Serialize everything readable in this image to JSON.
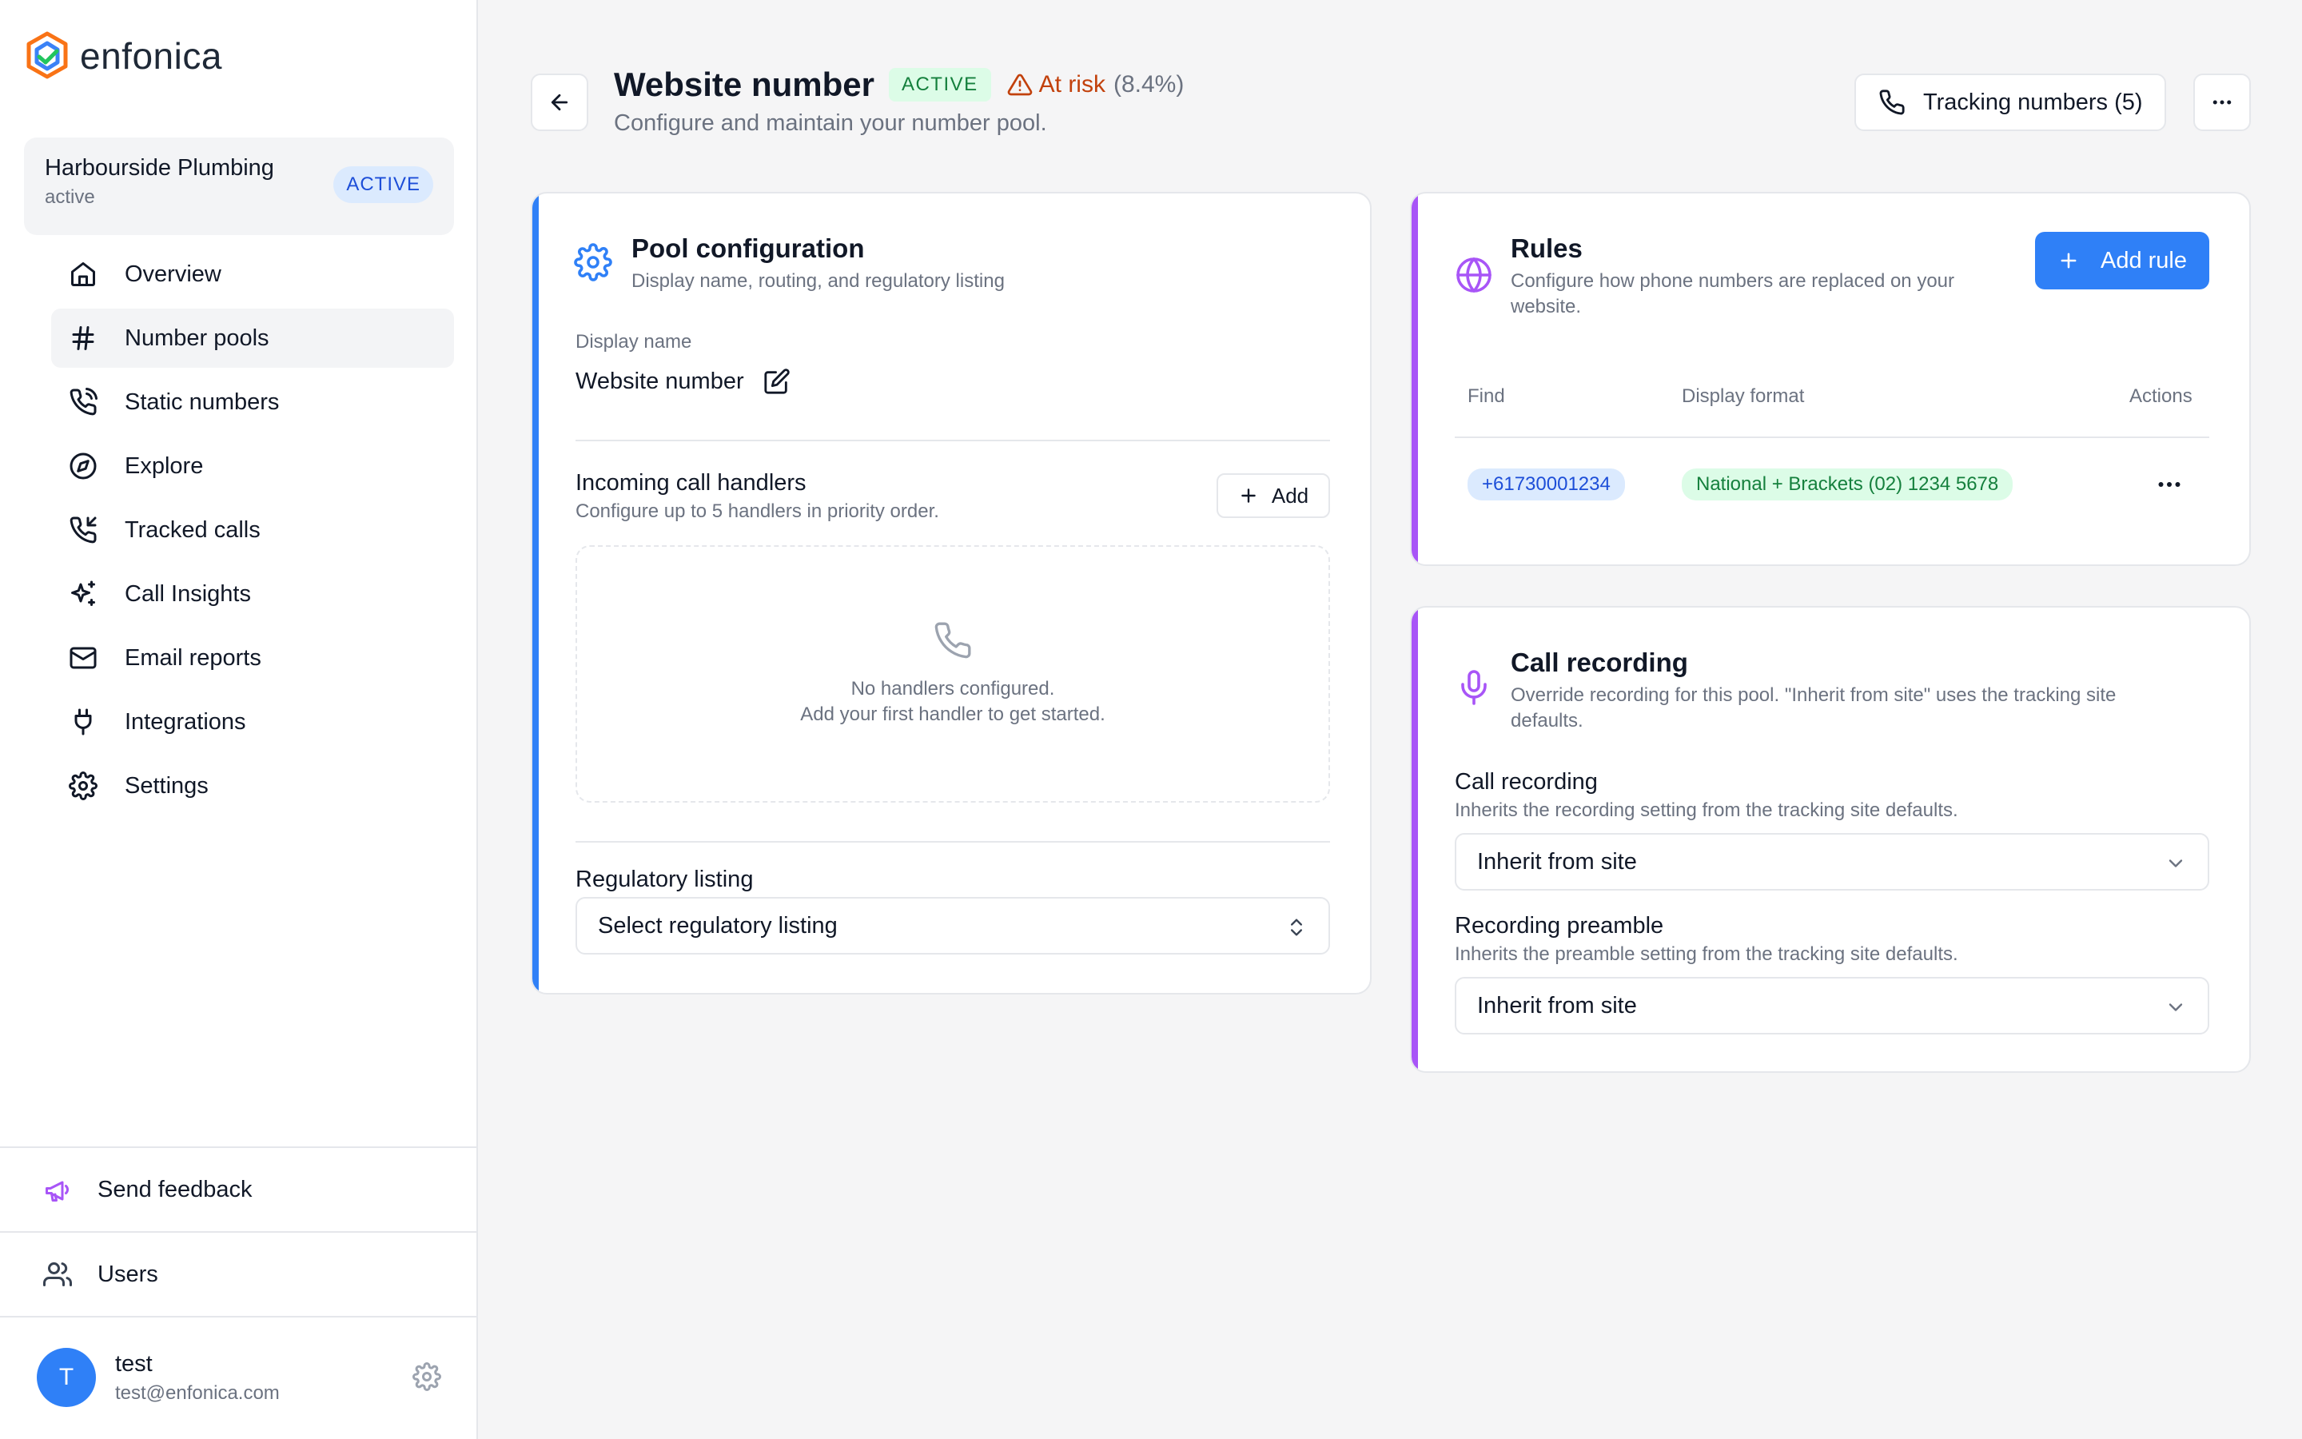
{
  "brand": {
    "name": "enfonica"
  },
  "account": {
    "name": "Harbourside Plumbing",
    "status": "active",
    "badge": "ACTIVE"
  },
  "nav": [
    {
      "label": "Overview",
      "icon": "home-icon",
      "active": false
    },
    {
      "label": "Number pools",
      "icon": "hash-icon",
      "active": true
    },
    {
      "label": "Static numbers",
      "icon": "phone-icon",
      "active": false
    },
    {
      "label": "Explore",
      "icon": "compass-icon",
      "active": false
    },
    {
      "label": "Tracked calls",
      "icon": "phone-incoming-icon",
      "active": false
    },
    {
      "label": "Call Insights",
      "icon": "sparkles-icon",
      "active": false
    },
    {
      "label": "Email reports",
      "icon": "mail-icon",
      "active": false
    },
    {
      "label": "Integrations",
      "icon": "plug-icon",
      "active": false
    },
    {
      "label": "Settings",
      "icon": "gear-icon",
      "active": false
    }
  ],
  "sidebar_bottom": {
    "feedback": "Send feedback",
    "users": "Users",
    "user": {
      "initial": "T",
      "name": "test",
      "email": "test@enfonica.com"
    }
  },
  "header": {
    "title": "Website number",
    "status_badge": "ACTIVE",
    "risk_label": "At risk",
    "risk_pct": "(8.4%)",
    "subtitle": "Configure and maintain your number pool.",
    "tracking_button": "Tracking numbers (5)"
  },
  "pool_config": {
    "title": "Pool configuration",
    "subtitle": "Display name, routing, and regulatory listing",
    "display_name_label": "Display name",
    "display_name_value": "Website number",
    "handlers_title": "Incoming call handlers",
    "handlers_sub": "Configure up to 5 handlers in priority order.",
    "add_label": "Add",
    "empty_line1": "No handlers configured.",
    "empty_line2": "Add your first handler to get started.",
    "regulatory_title": "Regulatory listing",
    "regulatory_placeholder": "Select regulatory listing"
  },
  "rules": {
    "title": "Rules",
    "subtitle_line1": "Configure how phone numbers are replaced on your",
    "subtitle_line2": "website.",
    "add_rule": "Add rule",
    "columns": [
      "Find",
      "Display format",
      "Actions"
    ],
    "rows": [
      {
        "find": "+61730001234",
        "format": "National + Brackets (02) 1234 5678"
      }
    ]
  },
  "call_recording": {
    "title": "Call recording",
    "subtitle_line1": "Override recording for this pool. \"Inherit from site\" uses the tracking site",
    "subtitle_line2": "defaults.",
    "recording_label": "Call recording",
    "recording_sub": "Inherits the recording setting from the tracking site defaults.",
    "recording_value": "Inherit from site",
    "preamble_label": "Recording preamble",
    "preamble_sub": "Inherits the preamble setting from the tracking site defaults.",
    "preamble_value": "Inherit from site"
  },
  "colors": {
    "accent_blue": "#2f80f7",
    "accent_purple": "#a855f7",
    "risk": "#c2410c",
    "success": "#15803d"
  }
}
